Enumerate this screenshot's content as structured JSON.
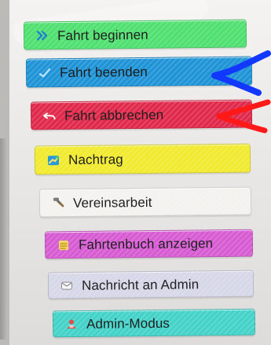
{
  "menu": {
    "items": [
      {
        "label": "Fahrt beginnen",
        "icon": "double-chevron-right-icon",
        "color": "#4fe070"
      },
      {
        "label": "Fahrt beenden",
        "icon": "check-icon",
        "color": "#1e93d6"
      },
      {
        "label": "Fahrt abbrechen",
        "icon": "undo-icon",
        "color": "#e0284a"
      },
      {
        "label": "Nachtrag",
        "icon": "map-icon",
        "color": "#f1ea2f"
      },
      {
        "label": "Vereinsarbeit",
        "icon": "hammer-icon",
        "color": "#f3f2ef"
      },
      {
        "label": "Fahrtenbuch anzeigen",
        "icon": "list-icon",
        "color": "#d65bd2"
      },
      {
        "label": "Nachricht an Admin",
        "icon": "mail-icon",
        "color": "#d6d7e8"
      },
      {
        "label": "Admin-Modus",
        "icon": "admin-icon",
        "color": "#43d2c8"
      }
    ]
  },
  "annotations": {
    "blue_arrow_color": "#1238ff",
    "red_arrow_color": "#ff1a1a"
  }
}
